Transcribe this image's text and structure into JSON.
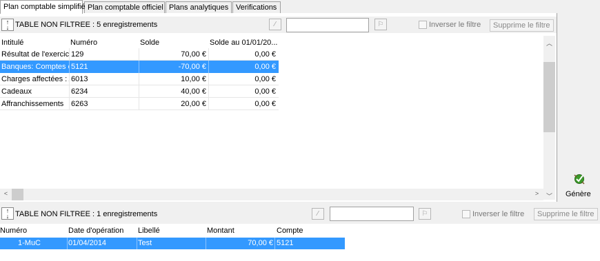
{
  "tabs": [
    {
      "label": "Plan comptable simplifié",
      "active": true
    },
    {
      "label": "Plan comptable officiel",
      "active": false
    },
    {
      "label": "Plans analytiques",
      "active": false
    },
    {
      "label": "Verifications",
      "active": false
    }
  ],
  "top_toolbar": {
    "status": "TABLE NON FILTREE : 5 enregistrements",
    "invert_filter_label": "Inverser le filtre",
    "remove_filter_label": "Supprime le filtre",
    "filter_value": ""
  },
  "top_grid": {
    "columns": [
      "Intitulé",
      "Numéro",
      "Solde",
      "Solde au 01/01/20..."
    ],
    "rows": [
      {
        "intitule": "Résultat de l'exercice",
        "numero": "129",
        "solde": "70,00 €",
        "solde_ouv": "0,00 €",
        "selected": false
      },
      {
        "intitule": "Banques: Comptes en banque",
        "numero": "5121",
        "solde": "-70,00 €",
        "solde_ouv": "0,00 €",
        "selected": true
      },
      {
        "intitule": "Charges affectées : Achats",
        "numero": "6013",
        "solde": "10,00 €",
        "solde_ouv": "0,00 €",
        "selected": false
      },
      {
        "intitule": "Cadeaux",
        "numero": "6234",
        "solde": "40,00 €",
        "solde_ouv": "0,00 €",
        "selected": false
      },
      {
        "intitule": "Affranchissements",
        "numero": "6263",
        "solde": "20,00 €",
        "solde_ouv": "0,00 €",
        "selected": false
      }
    ]
  },
  "right_panel": {
    "genere_label": "Génère",
    "genere_icon": "generate-icon"
  },
  "bottom_toolbar": {
    "status": "TABLE NON FILTREE : 1 enregistrements",
    "invert_filter_label": "Inverser le filtre",
    "remove_filter_label": "Supprime le filtre",
    "filter_value": ""
  },
  "bottom_grid": {
    "columns": [
      "Numéro",
      "Date d'opération",
      "Libellé",
      "Montant",
      "Compte"
    ],
    "rows": [
      {
        "numero": "1-MuC",
        "date": "01/04/2014",
        "libelle": "Test",
        "montant": "70,00 €",
        "compte": "5121",
        "selected": true
      }
    ]
  },
  "colors": {
    "selection": "#3399ff",
    "panel_bg": "#f0f0f0"
  }
}
